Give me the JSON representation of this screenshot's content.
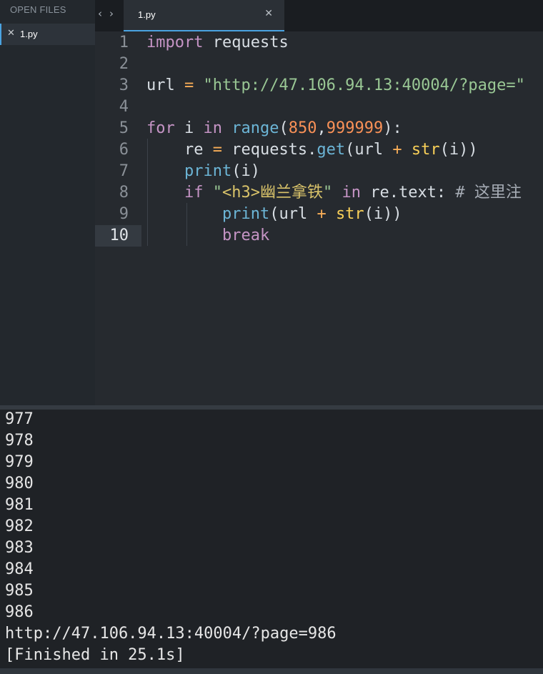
{
  "sidebar": {
    "header": "OPEN FILES",
    "files": [
      {
        "close_glyph": "✕",
        "name": "1.py"
      }
    ]
  },
  "nav": {
    "back": "‹",
    "forward": "›"
  },
  "tab": {
    "title": "1.py",
    "close_glyph": "✕"
  },
  "editor": {
    "active_line": 10,
    "line_numbers": [
      "1",
      "2",
      "3",
      "4",
      "5",
      "6",
      "7",
      "8",
      "9",
      "10"
    ],
    "lines": [
      [
        {
          "t": "import",
          "c": "kw"
        },
        {
          "t": " requests",
          "c": ""
        }
      ],
      [],
      [
        {
          "t": "url",
          "c": ""
        },
        {
          "t": " = ",
          "c": "op"
        },
        {
          "t": "\"http://47.106.94.13:40004/?page=\"",
          "c": "str"
        }
      ],
      [],
      [
        {
          "t": "for",
          "c": "kw"
        },
        {
          "t": " i ",
          "c": ""
        },
        {
          "t": "in",
          "c": "kw"
        },
        {
          "t": " ",
          "c": ""
        },
        {
          "t": "range",
          "c": "fn"
        },
        {
          "t": "(",
          "c": ""
        },
        {
          "t": "850",
          "c": "num"
        },
        {
          "t": ",",
          "c": ""
        },
        {
          "t": "999999",
          "c": "num"
        },
        {
          "t": "):",
          "c": ""
        }
      ],
      [
        {
          "t": "    re ",
          "c": ""
        },
        {
          "t": "=",
          "c": "op"
        },
        {
          "t": " requests.",
          "c": ""
        },
        {
          "t": "get",
          "c": "fn"
        },
        {
          "t": "(url ",
          "c": ""
        },
        {
          "t": "+",
          "c": "op"
        },
        {
          "t": " ",
          "c": ""
        },
        {
          "t": "str",
          "c": "tag"
        },
        {
          "t": "(i))",
          "c": ""
        }
      ],
      [
        {
          "t": "    ",
          "c": ""
        },
        {
          "t": "print",
          "c": "fn"
        },
        {
          "t": "(i)",
          "c": ""
        }
      ],
      [
        {
          "t": "    ",
          "c": ""
        },
        {
          "t": "if",
          "c": "kw"
        },
        {
          "t": " \"",
          "c": "str"
        },
        {
          "t": "<h3>幽兰拿铁",
          "c": "strc"
        },
        {
          "t": "\"",
          "c": "str"
        },
        {
          "t": " ",
          "c": ""
        },
        {
          "t": "in",
          "c": "kw"
        },
        {
          "t": " re.text: ",
          "c": ""
        },
        {
          "t": "# 这里注",
          "c": "cm"
        }
      ],
      [
        {
          "t": "        ",
          "c": ""
        },
        {
          "t": "print",
          "c": "fn"
        },
        {
          "t": "(url ",
          "c": ""
        },
        {
          "t": "+",
          "c": "op"
        },
        {
          "t": " ",
          "c": ""
        },
        {
          "t": "str",
          "c": "tag"
        },
        {
          "t": "(i))",
          "c": ""
        }
      ],
      [
        {
          "t": "        ",
          "c": ""
        },
        {
          "t": "break",
          "c": "kw"
        }
      ]
    ]
  },
  "console": {
    "lines": [
      "977",
      "978",
      "979",
      "980",
      "981",
      "982",
      "983",
      "984",
      "985",
      "986",
      "http://47.106.94.13:40004/?page=986",
      "[Finished in 25.1s]"
    ]
  }
}
